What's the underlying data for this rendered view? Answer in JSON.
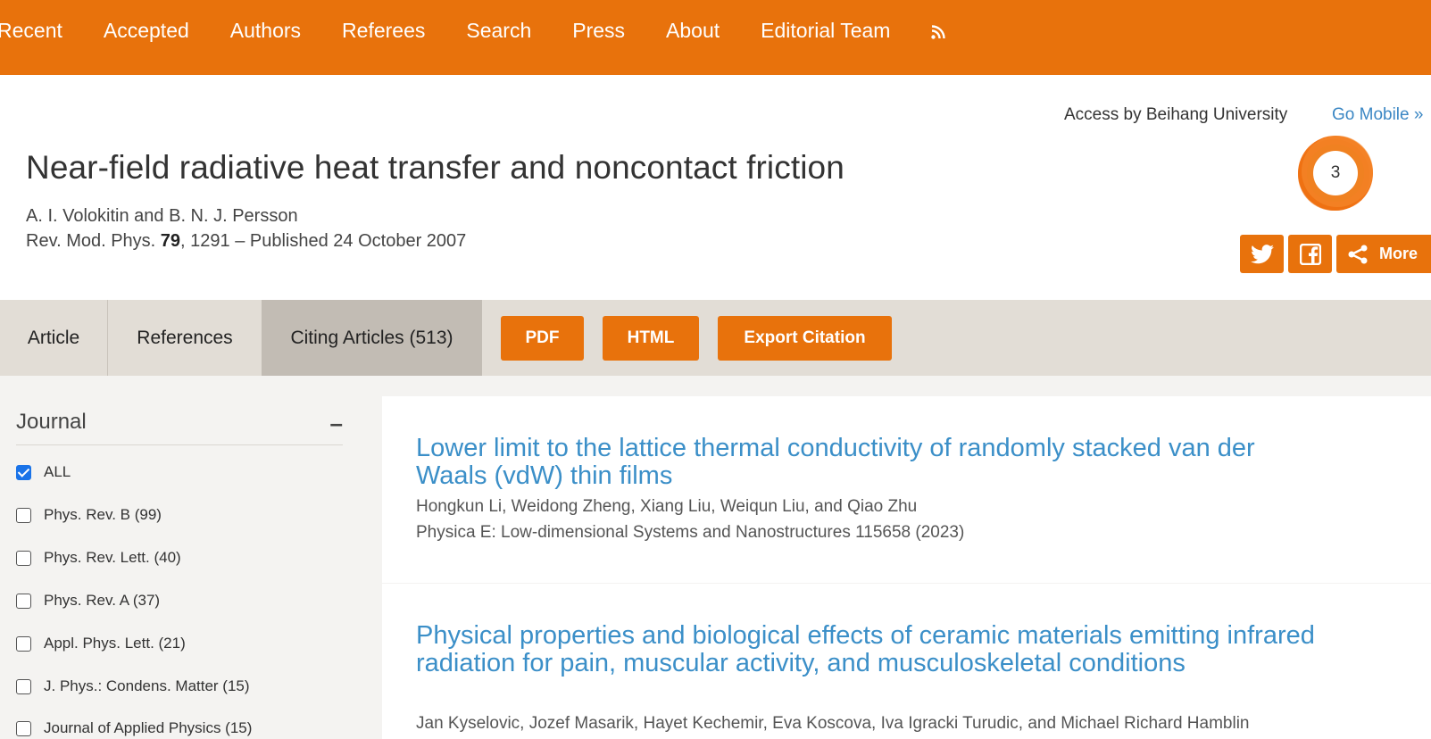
{
  "nav": {
    "items": [
      "Recent",
      "Accepted",
      "Authors",
      "Referees",
      "Search",
      "Press",
      "About",
      "Editorial Team"
    ],
    "rss_icon": "rss-icon",
    "color": "#e8720c"
  },
  "header": {
    "access": "Access by Beihang University",
    "go_mobile": "Go Mobile »",
    "title": "Near-field radiative heat transfer and noncontact friction",
    "authors": "A. I. Volokitin and B. N. J. Persson",
    "journal": "Rev. Mod. Phys.",
    "volume": "79",
    "pages_published": ", 1291 – Published 24 October 2007",
    "altmetric_score": "3",
    "share": {
      "more_label": "More",
      "icons": [
        "twitter-icon",
        "facebook-icon",
        "share-icon"
      ]
    }
  },
  "tabs": {
    "article": "Article",
    "references": "References",
    "citing": "Citing Articles (513)"
  },
  "actions": {
    "pdf": "PDF",
    "html": "HTML",
    "export": "Export Citation"
  },
  "sidebar": {
    "heading": "Journal",
    "collapse": "–",
    "filters": [
      {
        "label": "ALL",
        "checked": true
      },
      {
        "label": "Phys. Rev. B (99)",
        "checked": false
      },
      {
        "label": "Phys. Rev. Lett. (40)",
        "checked": false
      },
      {
        "label": "Phys. Rev. A (37)",
        "checked": false
      },
      {
        "label": "Appl. Phys. Lett. (21)",
        "checked": false
      },
      {
        "label": "J. Phys.: Condens. Matter (15)",
        "checked": false
      },
      {
        "label": "Journal of Applied Physics (15)",
        "checked": false
      }
    ]
  },
  "results": [
    {
      "title": "Lower limit to the lattice thermal conductivity of randomly stacked van der Waals (vdW) thin films",
      "authors": "Hongkun Li, Weidong Zheng, Xiang Liu, Weiqun Liu, and Qiao Zhu",
      "journal": "Physica E: Low-dimensional Systems and Nanostructures 115658 (2023)"
    },
    {
      "title": "Physical properties and biological effects of ceramic materials emitting infrared radiation for pain, muscular activity, and musculoskeletal conditions",
      "authors": "Jan Kyselovic, Jozef Masarik, Hayet Kechemir, Eva Koscova, Iva Igracki Turudic, and Michael Richard Hamblin"
    }
  ]
}
